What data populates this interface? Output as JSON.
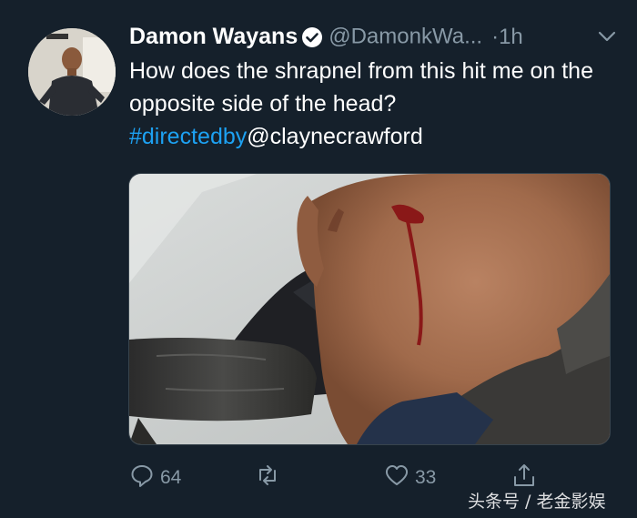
{
  "tweet": {
    "author_name": "Damon Wayans",
    "handle": "@DamonkWa...",
    "time": "·1h",
    "text_line_main": "How does the shrapnel from this hit me on the opposite side of the head?",
    "hashtag": "#directedby",
    "mention": "@claynecrawford"
  },
  "actions": {
    "reply_count": "64",
    "retweet_count": "",
    "like_count": "33"
  },
  "watermark": "头条号 / 老金影娱",
  "colors": {
    "background": "#15202b",
    "link": "#1da1f2",
    "muted": "#8899a6"
  }
}
